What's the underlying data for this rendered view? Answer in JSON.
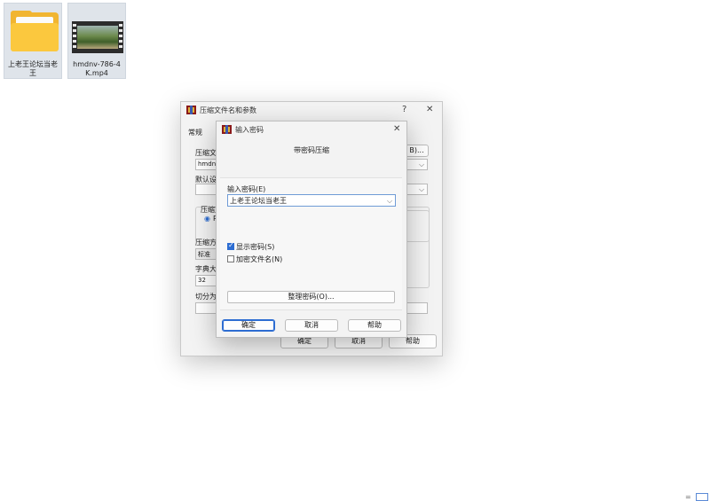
{
  "desktop": {
    "icons": [
      {
        "label": "上老王论坛当老王",
        "icon": "folder-icon"
      },
      {
        "label": "hmdnv-786-4K.mp4",
        "icon": "video-file-icon"
      }
    ]
  },
  "archive_dialog": {
    "title": "压缩文件名和参数",
    "help_glyph": "?",
    "close_glyph": "✕",
    "tab": "常规",
    "archive_name_label": "压缩文",
    "archive_name_value": "hmdnv",
    "browse_button": "B)...",
    "default_settings_label": "默认设",
    "format_group_label": "压缩文",
    "format_radio_label": "R",
    "method_label": "压缩方",
    "method_value": "标准",
    "dict_label": "字典大",
    "dict_value": "32",
    "split_label": "切分为",
    "ok": "确定",
    "cancel": "取消",
    "help": "帮助"
  },
  "password_dialog": {
    "title": "输入密码",
    "close_glyph": "✕",
    "heading": "带密码压缩",
    "password_label": "输入密码(E)",
    "password_value": "上老王论坛当老王",
    "show_password": {
      "label": "显示密码(S)",
      "checked": true
    },
    "encrypt_filenames": {
      "label": "加密文件名(N)",
      "checked": false
    },
    "organize_button": "整理密码(O)...",
    "ok": "确定",
    "cancel": "取消",
    "help": "帮助"
  },
  "taskbar_corner": {
    "glyph": "="
  }
}
